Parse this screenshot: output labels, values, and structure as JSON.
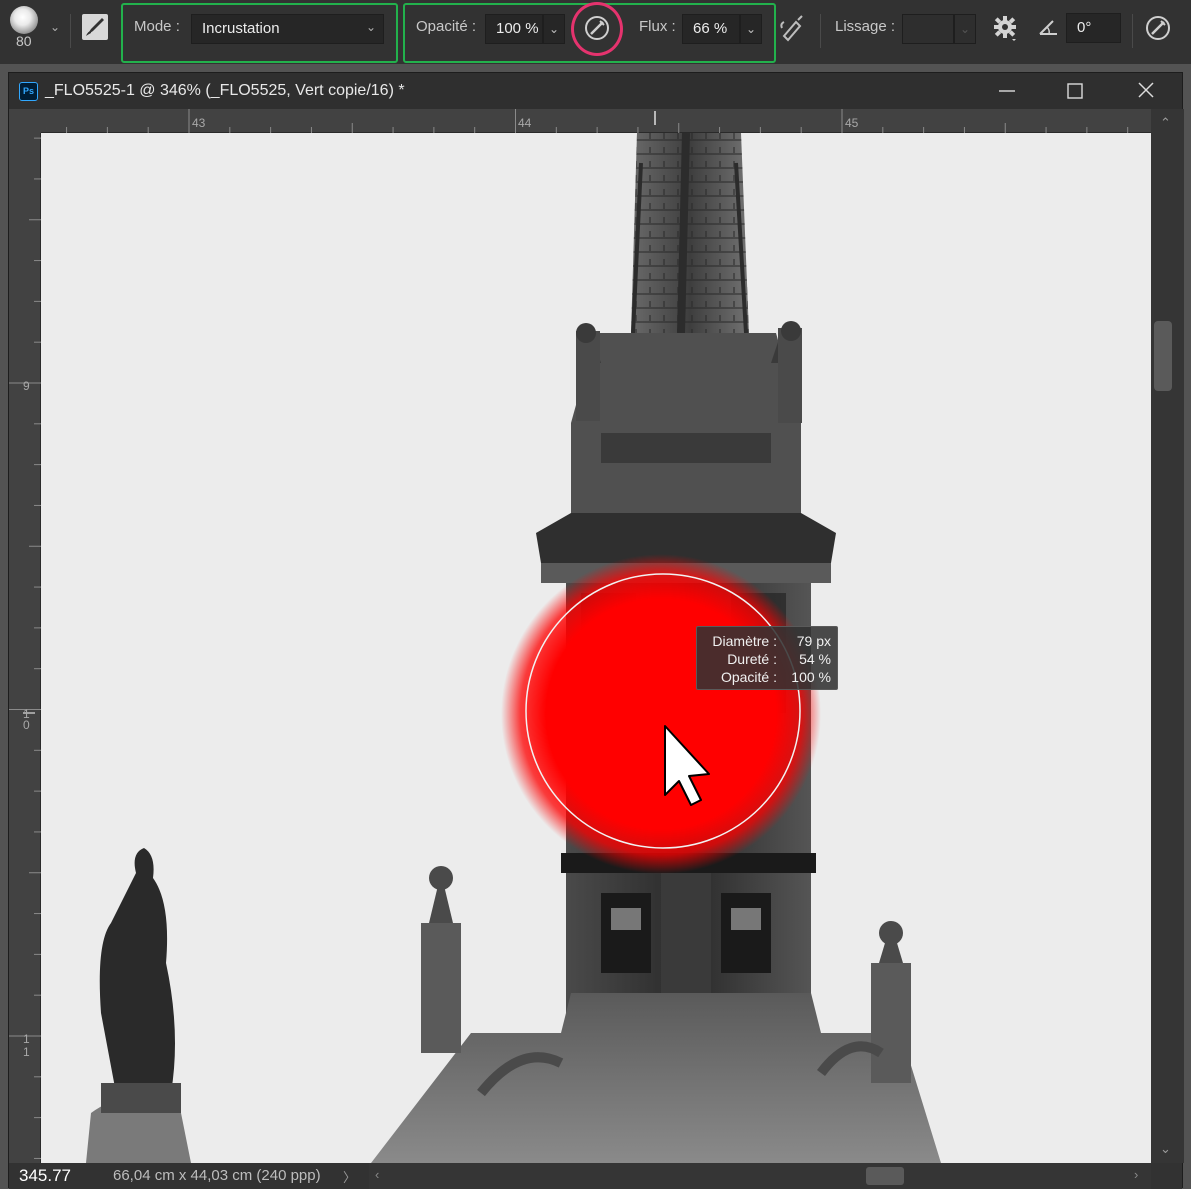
{
  "options_bar": {
    "brush_size": "80",
    "mode_label": "Mode :",
    "mode_value": "Incrustation",
    "opacity_label": "Opacité :",
    "opacity_value": "100 %",
    "flow_label": "Flux :",
    "flow_value": "66 %",
    "smoothing_label": "Lissage :",
    "smoothing_value": "",
    "angle_value": "0°",
    "icons": [
      "brush-preset-icon",
      "toggle-brush-panel-icon",
      "pressure-opacity-icon",
      "airbrush-icon",
      "smoothing-settings-icon",
      "angle-icon",
      "pressure-size-icon"
    ]
  },
  "document": {
    "title": "_FLO5525-1 @ 346% (_FLO5525, Vert copie/16) *",
    "app_badge": "Ps"
  },
  "rulers": {
    "horizontal": [
      "43",
      "44",
      "45"
    ],
    "vertical": [
      "9",
      "1\n0",
      "1\n1"
    ]
  },
  "brush_tooltip": {
    "rows": [
      {
        "label": "Diamètre :",
        "value": "79 px"
      },
      {
        "label": "Dureté :",
        "value": "54 %"
      },
      {
        "label": "Opacité :",
        "value": "100 %"
      }
    ]
  },
  "status": {
    "zoom": "345.77",
    "doc_size": "66,04 cm x 44,03 cm (240 ppp)",
    "more_label": "〉"
  },
  "colors": {
    "highlight_box": "#22b14c",
    "highlight_circle": "#e5336e",
    "brush_fill": "#ff0000",
    "ps_badge": "#31a8ff"
  }
}
